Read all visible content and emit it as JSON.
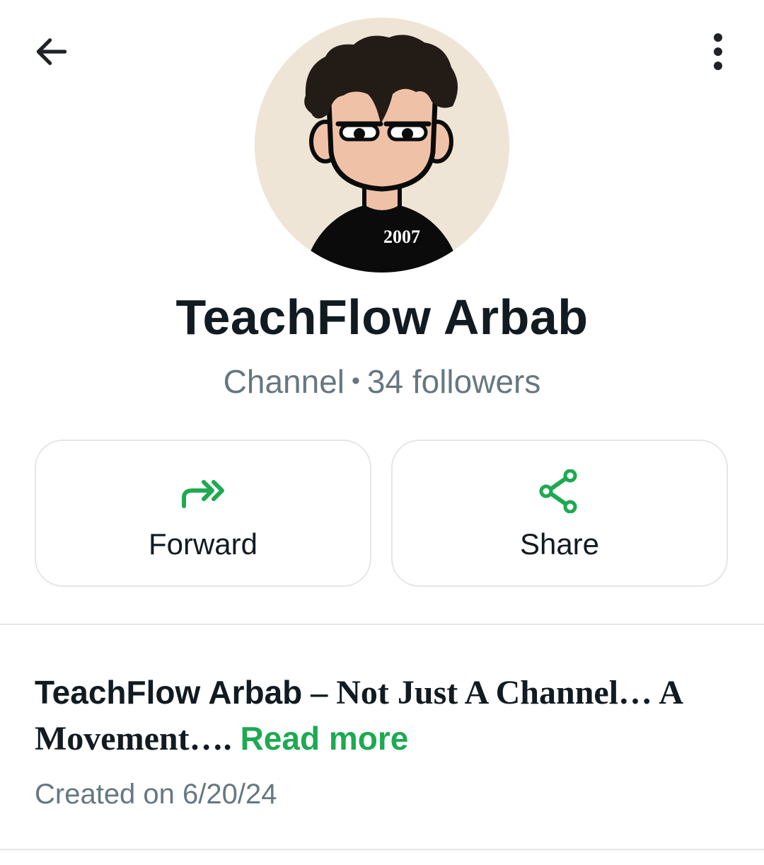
{
  "header": {
    "back_icon": "arrow-left-icon",
    "menu_icon": "more-vertical-icon"
  },
  "profile": {
    "avatar_shirt_text": "2007",
    "name": "TeachFlow Arbab",
    "type_label": "Channel",
    "separator": "•",
    "followers": "34 followers"
  },
  "actions": {
    "forward": {
      "label": "Forward",
      "icon": "forward-icon"
    },
    "share": {
      "label": "Share",
      "icon": "share-icon"
    }
  },
  "description": {
    "name": "TeachFlow Arbab",
    "text": " – Not Just A Channel… A Movement…. ",
    "read_more": "Read more"
  },
  "created": "Created on 6/20/24",
  "colors": {
    "accent_green": "#1ea952",
    "text_primary": "#111b21",
    "text_secondary": "#667781"
  }
}
